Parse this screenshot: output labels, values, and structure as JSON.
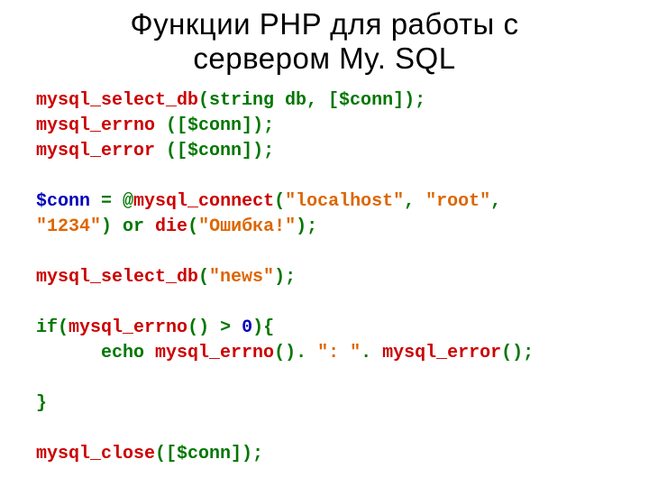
{
  "title_line1": "Функции PHP для работы с",
  "title_line2": "сервером My. SQL",
  "tokens": {
    "l1_fn": "mysql_select_db",
    "l1_args": "(string db, [$conn]);",
    "l2_fn": "mysql_errno",
    "l2_space": " ",
    "l2_args": "([$conn]);",
    "l3_fn": "mysql_error",
    "l3_space": " ",
    "l3_args": "([$conn]);",
    "l5_var": "$conn ",
    "l5_eq": "= ",
    "l5_at": "@",
    "l5_fn": "mysql_connect",
    "l5_p1": "(",
    "l5_host": "\"localhost\"",
    "l5_c1": ", ",
    "l5_user": "\"root\"",
    "l5_c2": ",",
    "l6_pw": "\"1234\"",
    "l6_p2": ") ",
    "l6_or": "or ",
    "l6_die": "die",
    "l6_p3": "(",
    "l6_msg": "\"Ошибка!\"",
    "l6_p4": ");",
    "l8_fn": "mysql_select_db",
    "l8_p1": "(",
    "l8_arg": "\"news\"",
    "l8_p2": ");",
    "l10_if": "if",
    "l10_p1": "(",
    "l10_fn": "mysql_errno",
    "l10_p2": "() > ",
    "l10_zero": "0",
    "l10_p3": "){",
    "l11_indent": "      echo ",
    "l11_fn1": "mysql_errno",
    "l11_p1": "(). ",
    "l11_str": "\": \"",
    "l11_p2": ". ",
    "l11_fn2": "mysql_error",
    "l11_p3": "();",
    "l13_brace": "}",
    "l15_fn": "mysql_close",
    "l15_args": "([$conn]);"
  }
}
